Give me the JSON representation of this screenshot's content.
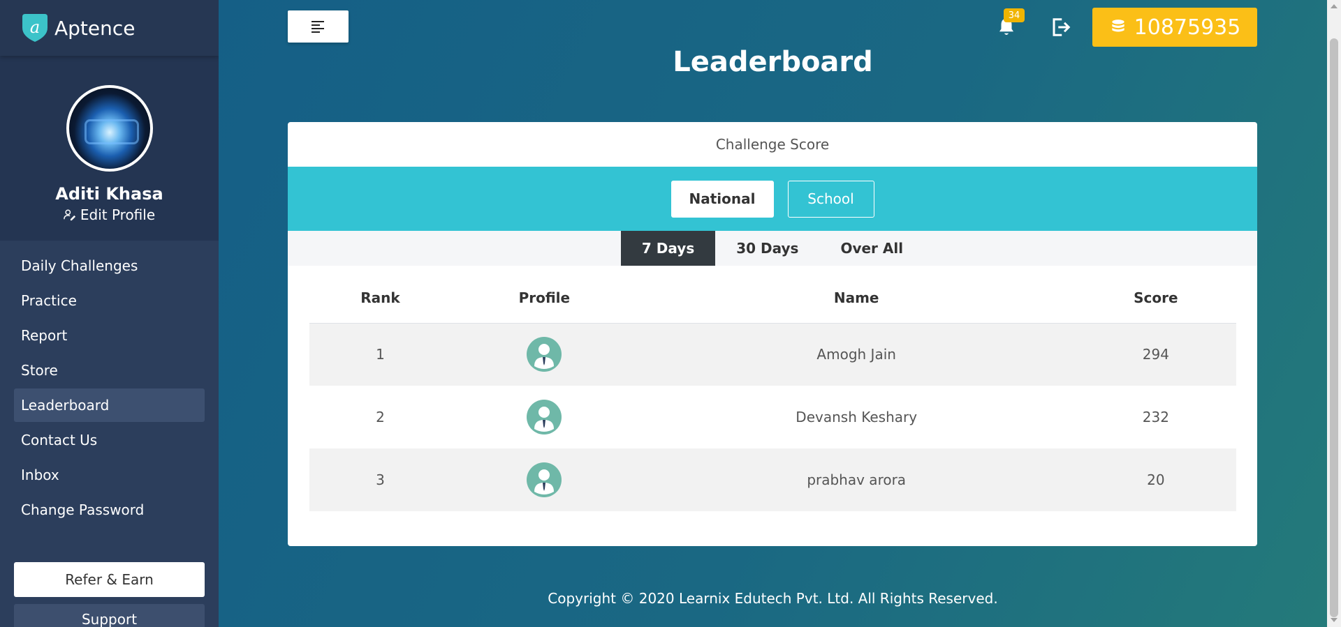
{
  "brand": {
    "name": "Aptence"
  },
  "user": {
    "name": "Aditi Khasa",
    "edit_label": "Edit Profile"
  },
  "sidebar": {
    "items": [
      {
        "label": "Daily Challenges",
        "active": false
      },
      {
        "label": "Practice",
        "active": false
      },
      {
        "label": "Report",
        "active": false
      },
      {
        "label": "Store",
        "active": false
      },
      {
        "label": "Leaderboard",
        "active": true
      },
      {
        "label": "Contact Us",
        "active": false
      },
      {
        "label": "Inbox",
        "active": false
      },
      {
        "label": "Change Password",
        "active": false
      }
    ],
    "refer_label": "Refer & Earn",
    "support_label": "Support"
  },
  "header": {
    "notification_count": "34",
    "coins": "10875935"
  },
  "page": {
    "title": "Leaderboard"
  },
  "leaderboard": {
    "heading": "Challenge Score",
    "scopes": [
      {
        "label": "National",
        "active": true
      },
      {
        "label": "School",
        "active": false
      }
    ],
    "periods": [
      {
        "label": "7 Days",
        "active": true
      },
      {
        "label": "30 Days",
        "active": false
      },
      {
        "label": "Over All",
        "active": false
      }
    ],
    "columns": [
      "Rank",
      "Profile",
      "Name",
      "Score"
    ],
    "rows": [
      {
        "rank": "1",
        "name": "Amogh Jain",
        "score": "294"
      },
      {
        "rank": "2",
        "name": "Devansh Keshary",
        "score": "232"
      },
      {
        "rank": "3",
        "name": "prabhav arora",
        "score": "20"
      }
    ]
  },
  "footer": {
    "copyright": "Copyright © 2020 Learnix Edutech Pvt. Ltd. All Rights Reserved."
  },
  "colors": {
    "sidebar_bg": "#2c3e5c",
    "accent_yellow": "#fbbf17",
    "scope_bar": "#33c3d3",
    "active_period": "#333a40",
    "avatar_teal": "#6fb8a8"
  }
}
